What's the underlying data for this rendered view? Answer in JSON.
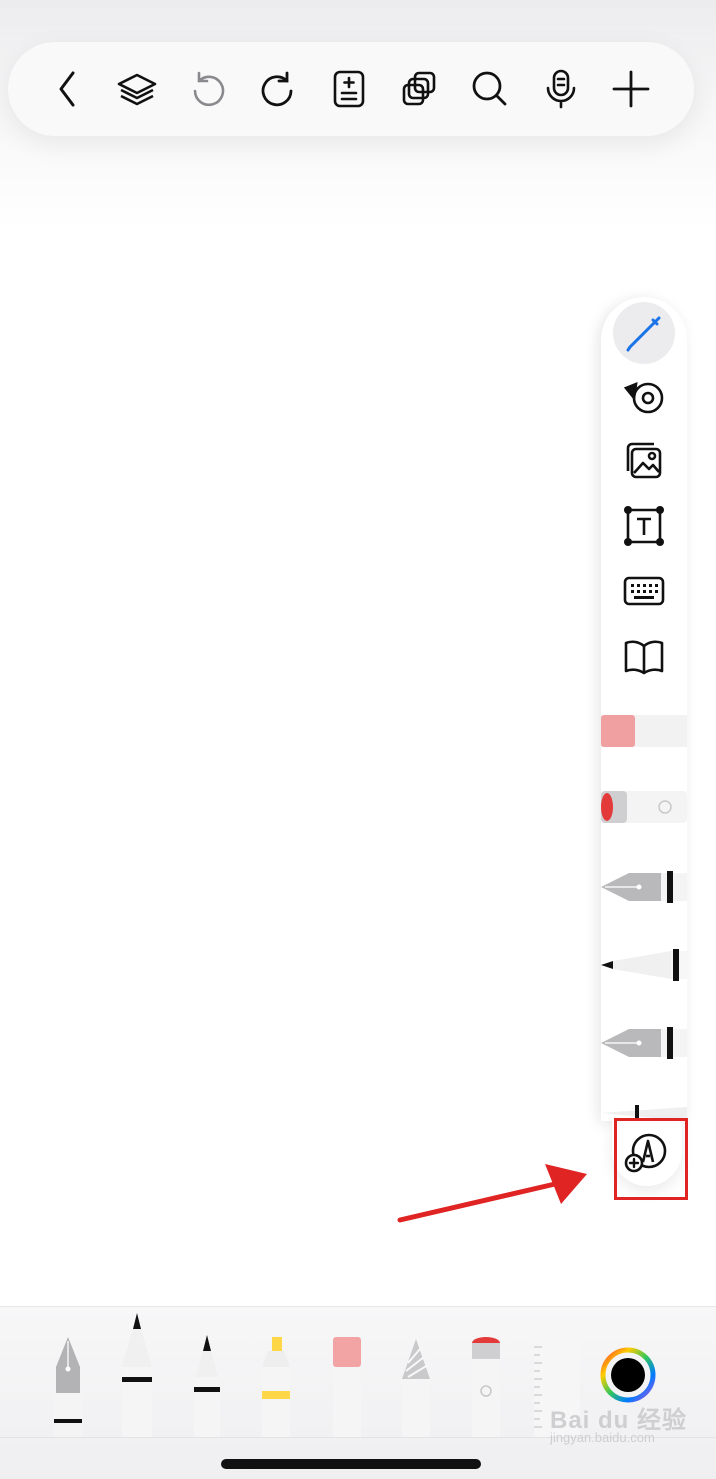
{
  "top_toolbar": {
    "buttons": [
      {
        "icon": "back-chevron-icon"
      },
      {
        "icon": "layers-icon"
      },
      {
        "icon": "undo-icon"
      },
      {
        "icon": "redo-icon"
      },
      {
        "icon": "page-add-icon"
      },
      {
        "icon": "duplicate-icon"
      },
      {
        "icon": "search-icon"
      },
      {
        "icon": "microphone-icon"
      },
      {
        "icon": "plus-icon"
      }
    ]
  },
  "side_palette": {
    "active": "pen-mode",
    "buttons": [
      "pen-icon",
      "tape-icon",
      "image-icon",
      "textbox-icon",
      "keyboard-icon",
      "book-icon"
    ],
    "tools": [
      "eraser",
      "lasso-eraser",
      "fountain-pen",
      "ballpoint-pen",
      "fountain-pen-2"
    ],
    "add_tool_icon": "add-pen-icon"
  },
  "bottom_tray": {
    "tools": [
      "fountain-pen",
      "ballpoint-pen",
      "fineliner",
      "highlighter",
      "eraser",
      "pencil",
      "lasso-eraser",
      "ruler"
    ],
    "color_picker": {
      "selected": "#000000"
    }
  },
  "watermark": {
    "main": "Bai du 经验",
    "sub": "jingyan.baidu.com"
  },
  "colors": {
    "accent": "#1a73e8",
    "annotation": "#e02424",
    "highlighter": "#ffd645"
  }
}
